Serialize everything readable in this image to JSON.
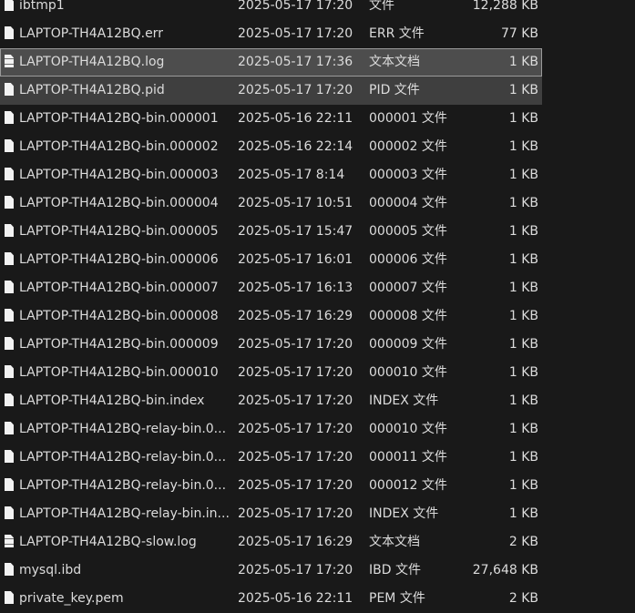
{
  "files": [
    {
      "name": "ibtmp1",
      "date": "2025-05-17 17:20",
      "type": "文件",
      "size": "12,288 KB",
      "icon": "file-icon",
      "state": ""
    },
    {
      "name": "LAPTOP-TH4A12BQ.err",
      "date": "2025-05-17 17:20",
      "type": "ERR 文件",
      "size": "77 KB",
      "icon": "file-icon",
      "state": ""
    },
    {
      "name": "LAPTOP-TH4A12BQ.log",
      "date": "2025-05-17 17:36",
      "type": "文本文档",
      "size": "1 KB",
      "icon": "text-document-icon",
      "state": "selected"
    },
    {
      "name": "LAPTOP-TH4A12BQ.pid",
      "date": "2025-05-17 17:20",
      "type": "PID 文件",
      "size": "1 KB",
      "icon": "file-icon",
      "state": "hover"
    },
    {
      "name": "LAPTOP-TH4A12BQ-bin.000001",
      "date": "2025-05-16 22:11",
      "type": "000001 文件",
      "size": "1 KB",
      "icon": "file-icon",
      "state": ""
    },
    {
      "name": "LAPTOP-TH4A12BQ-bin.000002",
      "date": "2025-05-16 22:14",
      "type": "000002 文件",
      "size": "1 KB",
      "icon": "file-icon",
      "state": ""
    },
    {
      "name": "LAPTOP-TH4A12BQ-bin.000003",
      "date": "2025-05-17 8:14",
      "type": "000003 文件",
      "size": "1 KB",
      "icon": "file-icon",
      "state": ""
    },
    {
      "name": "LAPTOP-TH4A12BQ-bin.000004",
      "date": "2025-05-17 10:51",
      "type": "000004 文件",
      "size": "1 KB",
      "icon": "file-icon",
      "state": ""
    },
    {
      "name": "LAPTOP-TH4A12BQ-bin.000005",
      "date": "2025-05-17 15:47",
      "type": "000005 文件",
      "size": "1 KB",
      "icon": "file-icon",
      "state": ""
    },
    {
      "name": "LAPTOP-TH4A12BQ-bin.000006",
      "date": "2025-05-17 16:01",
      "type": "000006 文件",
      "size": "1 KB",
      "icon": "file-icon",
      "state": ""
    },
    {
      "name": "LAPTOP-TH4A12BQ-bin.000007",
      "date": "2025-05-17 16:13",
      "type": "000007 文件",
      "size": "1 KB",
      "icon": "file-icon",
      "state": ""
    },
    {
      "name": "LAPTOP-TH4A12BQ-bin.000008",
      "date": "2025-05-17 16:29",
      "type": "000008 文件",
      "size": "1 KB",
      "icon": "file-icon",
      "state": ""
    },
    {
      "name": "LAPTOP-TH4A12BQ-bin.000009",
      "date": "2025-05-17 17:20",
      "type": "000009 文件",
      "size": "1 KB",
      "icon": "file-icon",
      "state": ""
    },
    {
      "name": "LAPTOP-TH4A12BQ-bin.000010",
      "date": "2025-05-17 17:20",
      "type": "000010 文件",
      "size": "1 KB",
      "icon": "file-icon",
      "state": ""
    },
    {
      "name": "LAPTOP-TH4A12BQ-bin.index",
      "date": "2025-05-17 17:20",
      "type": "INDEX 文件",
      "size": "1 KB",
      "icon": "file-icon",
      "state": ""
    },
    {
      "name": "LAPTOP-TH4A12BQ-relay-bin.0...",
      "date": "2025-05-17 17:20",
      "type": "000010 文件",
      "size": "1 KB",
      "icon": "file-icon",
      "state": ""
    },
    {
      "name": "LAPTOP-TH4A12BQ-relay-bin.0...",
      "date": "2025-05-17 17:20",
      "type": "000011 文件",
      "size": "1 KB",
      "icon": "file-icon",
      "state": ""
    },
    {
      "name": "LAPTOP-TH4A12BQ-relay-bin.0...",
      "date": "2025-05-17 17:20",
      "type": "000012 文件",
      "size": "1 KB",
      "icon": "file-icon",
      "state": ""
    },
    {
      "name": "LAPTOP-TH4A12BQ-relay-bin.in...",
      "date": "2025-05-17 17:20",
      "type": "INDEX 文件",
      "size": "1 KB",
      "icon": "file-icon",
      "state": ""
    },
    {
      "name": "LAPTOP-TH4A12BQ-slow.log",
      "date": "2025-05-17 16:29",
      "type": "文本文档",
      "size": "2 KB",
      "icon": "text-document-icon",
      "state": ""
    },
    {
      "name": "mysql.ibd",
      "date": "2025-05-17 17:20",
      "type": "IBD 文件",
      "size": "27,648 KB",
      "icon": "file-icon",
      "state": ""
    },
    {
      "name": "private_key.pem",
      "date": "2025-05-16 22:11",
      "type": "PEM 文件",
      "size": "2 KB",
      "icon": "file-icon",
      "state": ""
    }
  ]
}
